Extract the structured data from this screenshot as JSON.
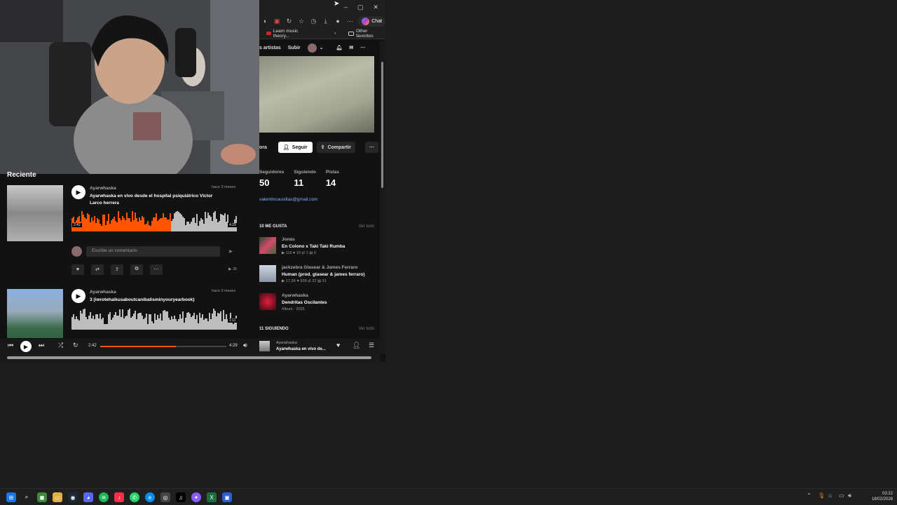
{
  "window": {
    "minimize": "–",
    "maximize": "▢",
    "close": "✕"
  },
  "toolbar": {
    "chat_label": "Chat"
  },
  "favorites": {
    "item1": "Learn music theory...",
    "item2": "Other favorites"
  },
  "site_nav": {
    "artists": "s artistas",
    "upload": "Subir"
  },
  "profile": {
    "follow": "Seguir",
    "share": "Compartir",
    "left_cut": "ora",
    "stats": [
      {
        "label": "Seguidores",
        "value": "50"
      },
      {
        "label": "Siguiendo",
        "value": "11"
      },
      {
        "label": "Pistas",
        "value": "14"
      }
    ],
    "email": "valentincausillas@gmail.com",
    "likes_header": "10 ME GUSTA",
    "likes_more": "Ver todo",
    "likes": [
      {
        "artist": "Jonás",
        "title": "En Colono x Taki Taki Rumba",
        "meta": "▶ 119  ♥ 10  ⇄ 1  ▤ 6"
      },
      {
        "artist": "jackzebra Glasear & James Ferraro",
        "title": "Human (prod. glasear & james ferraro)",
        "meta": "▶ 17,3K  ♥ 938  ⇄ 32  ▤ 31"
      },
      {
        "artist": "Ayarwhaska",
        "title": "Dendritas Oscilantes",
        "meta": "Álbum · 2025"
      }
    ],
    "following_header": "11 SIGUIENDO",
    "following_more": "Ver todo"
  },
  "feed": {
    "title": "Reciente",
    "tracks": [
      {
        "artist": "Ayarwhaska",
        "title": "Ayarwhaska en vivo desde el hospital psiquiátrico Víctor Larco herrera",
        "ago": "hace 3 meses",
        "cur": "2:42",
        "dur": "4:29",
        "progress": 0.6,
        "plays": "▶ 36",
        "comment_placeholder": "Escribe un comentario"
      },
      {
        "artist": "Ayarwhaska",
        "title": "3 (iwrotehaikusaboutcanibalisminyouryearbook)",
        "ago": "hace 3 meses",
        "dur": "1:11",
        "progress": 0
      }
    ]
  },
  "player": {
    "current": "2:42",
    "duration": "4:29",
    "progress": 0.6,
    "artist": "Ayarwhaska",
    "title": "Ayarwhaska en vivo de..."
  },
  "clock": {
    "time": "03:22",
    "date": "18/02/2026"
  },
  "colors": {
    "accent": "#ff5500",
    "bg": "#121212"
  }
}
